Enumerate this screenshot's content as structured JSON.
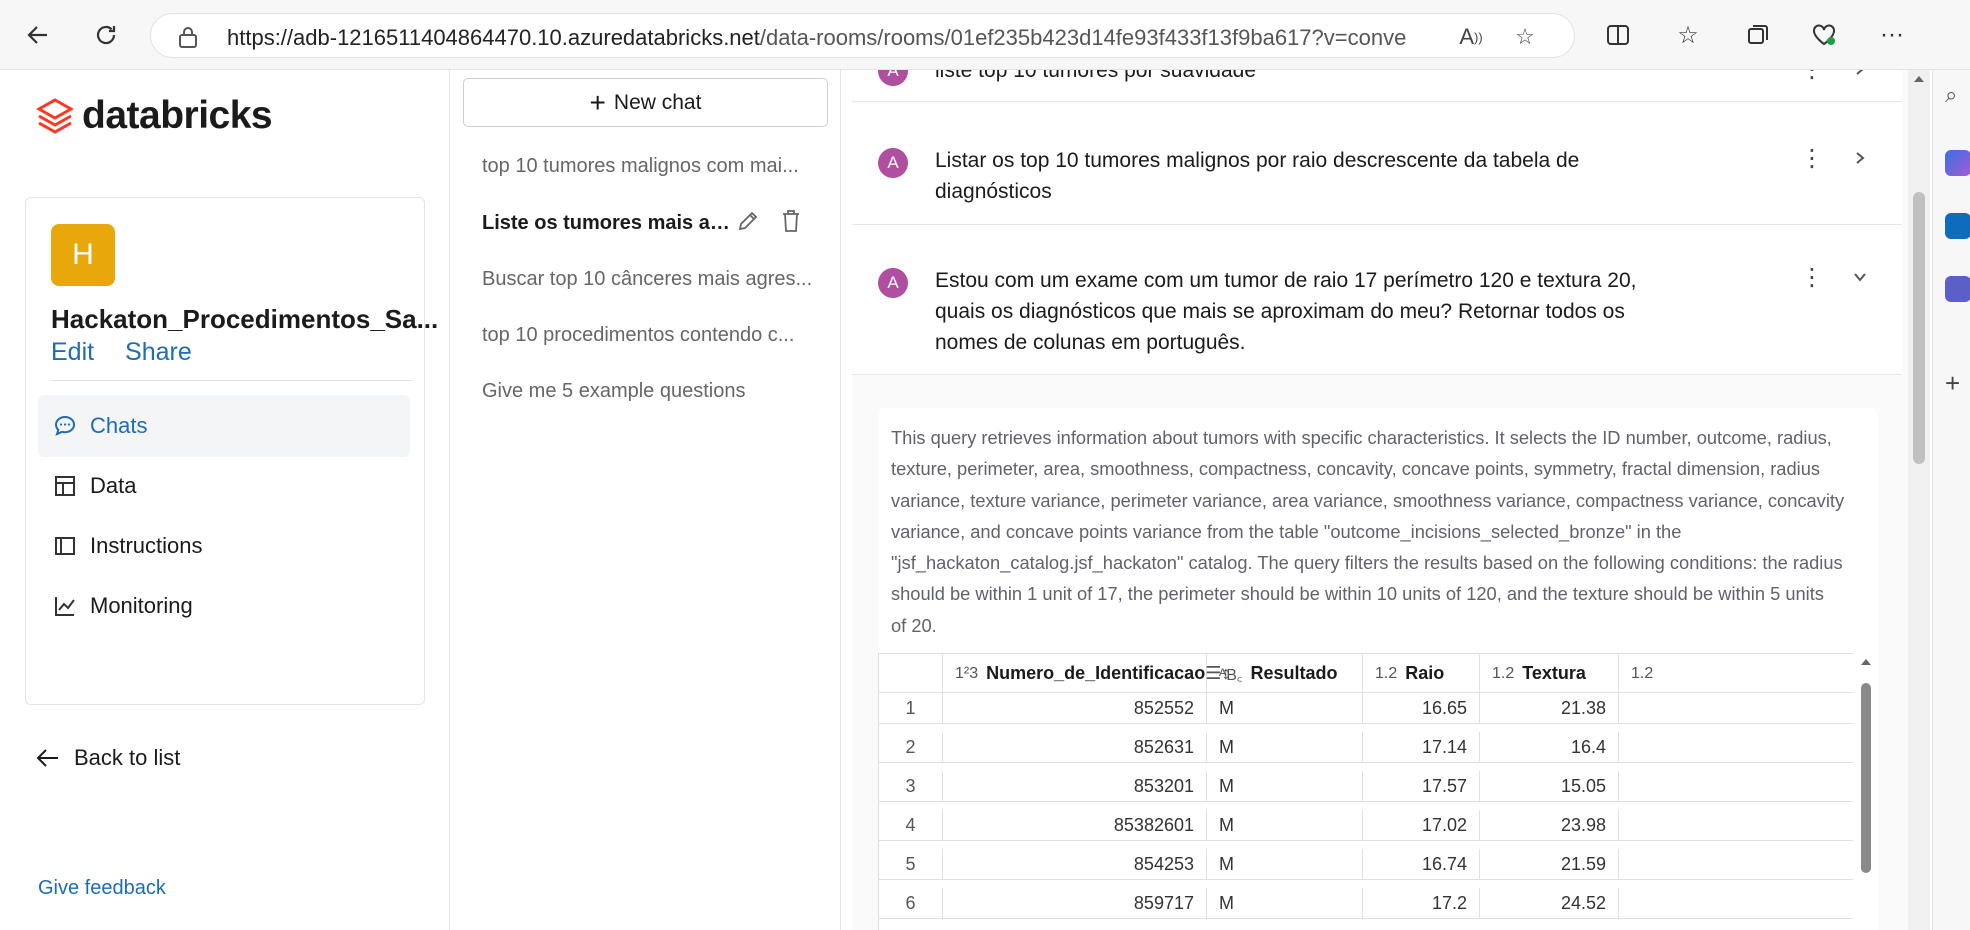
{
  "browser": {
    "url_host": "https://adb-1216511404864470.10.azuredatabricks.net",
    "url_path": "/data-rooms/rooms/01ef235b423d14fe93f433f13f9ba617?v=convers..."
  },
  "sidebar": {
    "brand": "databricks",
    "room_initial": "H",
    "room_name": "Hackaton_Procedimentos_Sa...",
    "edit_label": "Edit",
    "share_label": "Share",
    "items": [
      {
        "label": "Chats",
        "icon": "chat-bubble-icon",
        "active": true
      },
      {
        "label": "Data",
        "icon": "table-icon",
        "active": false
      },
      {
        "label": "Instructions",
        "icon": "book-icon",
        "active": false
      },
      {
        "label": "Monitoring",
        "icon": "line-chart-icon",
        "active": false
      }
    ],
    "back_label": "Back to list",
    "feedback_label": "Give feedback"
  },
  "chats": {
    "new_chat_label": "New chat",
    "items": [
      "top 10 tumores malignos com mai...",
      "Liste os tumores mais agr...",
      "Buscar top 10 cânceres mais agres...",
      "top 10 procedimentos contendo c...",
      "Give me 5 example questions"
    ]
  },
  "conversation": {
    "avatar_initial": "A",
    "messages": [
      {
        "text": "liste top 10 tumores por suavidade"
      },
      {
        "line1": "Listar os top 10 tumores malignos por raio descrescente da tabela de",
        "line2": "diagnósticos"
      },
      {
        "line1": "Estou com um exame com um tumor de raio 17 perímetro 120 e textura 20,",
        "line2": "quais os diagnósticos que mais se aproximam do meu? Retornar todos os",
        "line3": "nomes de colunas em português."
      }
    ],
    "answer": [
      "This query retrieves information about tumors with specific characteristics. It selects the ID number, outcome, radius,",
      "texture, perimeter, area, smoothness, compactness, concavity, concave points, symmetry, fractal dimension, radius",
      "variance, texture variance, perimeter variance, area variance, smoothness variance, compactness variance, concavity",
      "variance, and concave points variance from the table \"outcome_incisions_selected_bronze\" in the",
      "\"jsf_hackaton_catalog.jsf_hackaton\" catalog. The query filters the results based on the following conditions: the radius",
      "should be within 1 unit of 17, the perimeter should be within 10 units of 120, and the texture should be within 5 units",
      "of 20."
    ],
    "table": {
      "columns": [
        {
          "type": "1²3",
          "name": "Numero_de_Identificacao"
        },
        {
          "type": "ᴬB꜀",
          "name": "Resultado"
        },
        {
          "type": "1.2",
          "name": "Raio"
        },
        {
          "type": "1.2",
          "name": "Textura"
        },
        {
          "type": "1.2",
          "name": ""
        }
      ],
      "rows": [
        [
          "1",
          "852552",
          "M",
          "16.65",
          "21.38"
        ],
        [
          "2",
          "852631",
          "M",
          "17.14",
          "16.4"
        ],
        [
          "3",
          "853201",
          "M",
          "17.57",
          "15.05"
        ],
        [
          "4",
          "85382601",
          "M",
          "17.02",
          "23.98"
        ],
        [
          "5",
          "854253",
          "M",
          "16.74",
          "21.59"
        ],
        [
          "6",
          "859717",
          "M",
          "17.2",
          "24.52"
        ]
      ]
    }
  }
}
